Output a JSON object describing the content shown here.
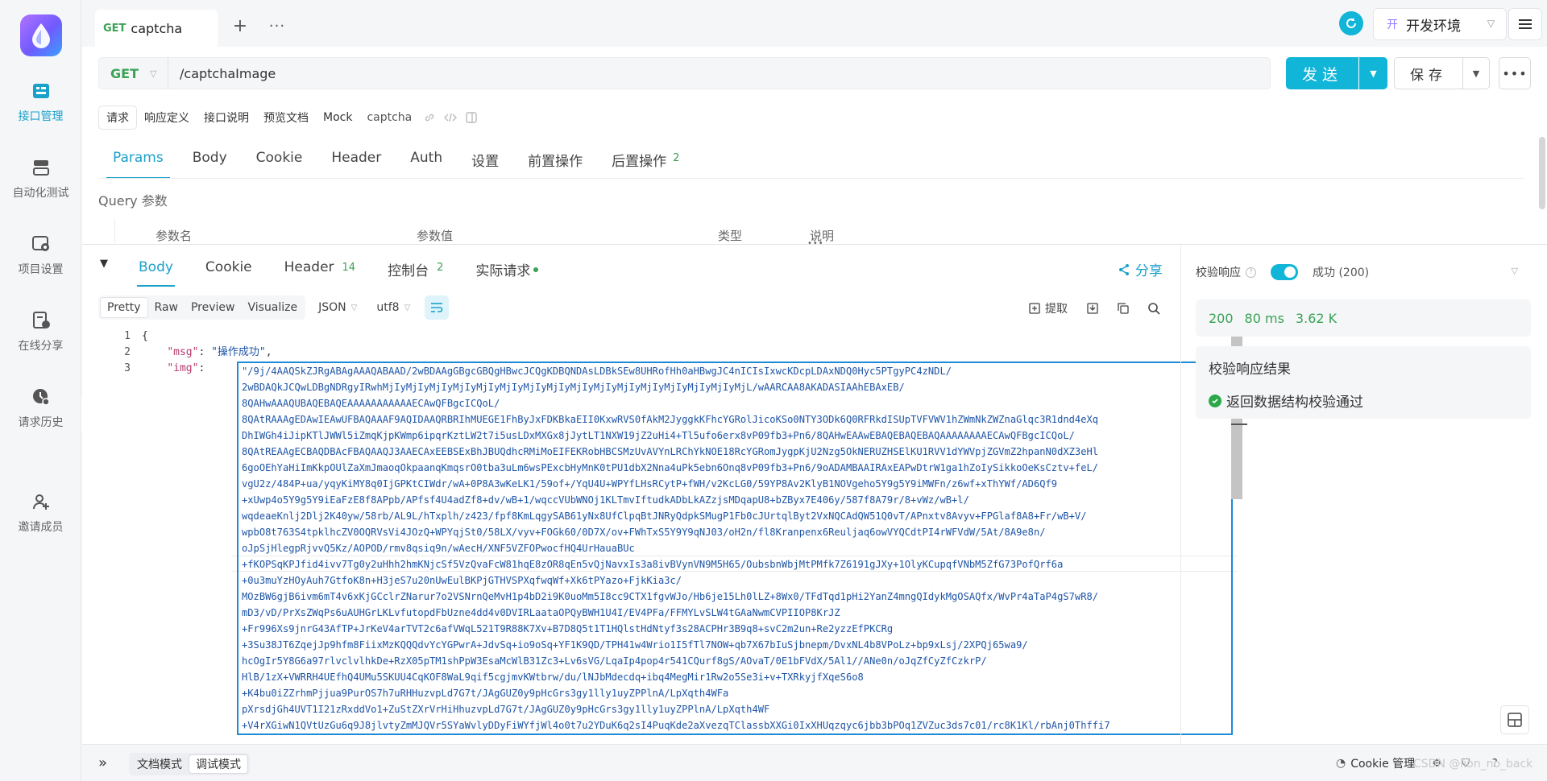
{
  "rail": {
    "items": [
      {
        "label": "接口管理",
        "icon": "api-icon",
        "active": true
      },
      {
        "label": "自动化测试",
        "icon": "automation-icon",
        "active": false
      },
      {
        "label": "项目设置",
        "icon": "project-settings-icon",
        "active": false
      },
      {
        "label": "在线分享",
        "icon": "share-doc-icon",
        "active": false
      },
      {
        "label": "请求历史",
        "icon": "history-icon",
        "active": false
      },
      {
        "label": "邀请成员",
        "icon": "invite-member-icon",
        "active": false
      }
    ],
    "toggle_glyph": "›"
  },
  "tabbar": {
    "tab_method": "GET",
    "tab_name": "captcha",
    "plus": "+",
    "more": "···",
    "env_badge": "开",
    "env_name": "开发环境"
  },
  "request": {
    "method": "GET",
    "url": "/captchaImage",
    "send_label": "发送",
    "save_label": "保存"
  },
  "mode_tabs": [
    "请求",
    "响应定义",
    "接口说明",
    "预览文档",
    "Mock"
  ],
  "api_name": "captcha",
  "req_tabs": [
    {
      "label": "Params",
      "count": ""
    },
    {
      "label": "Body",
      "count": ""
    },
    {
      "label": "Cookie",
      "count": ""
    },
    {
      "label": "Header",
      "count": ""
    },
    {
      "label": "Auth",
      "count": ""
    },
    {
      "label": "设置",
      "count": ""
    },
    {
      "label": "前置操作",
      "count": ""
    },
    {
      "label": "后置操作",
      "count": "2"
    }
  ],
  "query": {
    "title": "Query 参数",
    "columns": [
      "参数名",
      "参数值",
      "类型",
      "说明"
    ]
  },
  "response": {
    "tabs": [
      {
        "label": "Body",
        "count": ""
      },
      {
        "label": "Cookie",
        "count": ""
      },
      {
        "label": "Header",
        "count": "14"
      },
      {
        "label": "控制台",
        "count": "2"
      },
      {
        "label": "实际请求",
        "count": ""
      }
    ],
    "share_label": "分享",
    "formats": [
      "Pretty",
      "Raw",
      "Preview",
      "Visualize"
    ],
    "type_select": "JSON",
    "charset_select": "utf8",
    "extract_label": "提取",
    "line_numbers": [
      "1",
      "2",
      "3"
    ],
    "line1": "{",
    "msg_key": "\"msg\"",
    "msg_value": "\"操作成功\"",
    "img_key": "\"img\"",
    "img_lines": [
      "\"/9j/4AAQSkZJRgABAgAAAQABAAD/2wBDAAgGBgcGBQgHBwcJCQgKDBQNDAsLDBkSEw8UHRofHh0aHBwgJC4nICIsIxwcKDcpLDAxNDQ0Hyc5PTgyPC4zNDL/",
      "2wBDAQkJCQwLDBgNDRgyIRwhMjIyMjIyMjIyMjIyMjIyMjIyMjIyMjIyMjIyMjIyMjIyMjIyMjIyMjIyMjIyMjL/wAARCAA8AKADASIAAhEBAxEB/",
      "8QAHwAAAQUBAQEBAQEAAAAAAAAAAAECAwQFBgcICQoL/",
      "8QAtRAAAgEDAwIEAwUFBAQAAAF9AQIDAAQRBRIhMUEGE1FhByJxFDKBkaEII0KxwRVS0fAkM2JyggkKFhcYGRolJicoKSo0NTY3ODk6Q0RFRkdISUpTVFVWV1hZWmNkZWZnaGlqc3R1dnd4eXq",
      "DhIWGh4iJipKTlJWWl5iZmqKjpKWmp6ipqrKztLW2t7i5usLDxMXGx8jJytLT1NXW19jZ2uHi4+Tl5ufo6erx8vP09fb3+Pn6/8QAHwEAAwEBAQEBAQEBAQAAAAAAAAECAwQFBgcICQoL/",
      "8QAtREAAgECBAQDBAcFBAQAAQJ3AAECAxEEBSExBhJBUQdhcRMiMoEIFEKRobHBCSMzUvAVYnLRChYkNOE18RcYGRomJygpKjU2Nzg5OkNERUZHSElKU1RVV1dYWVpjZGVmZ2hpanN0dXZ3eHl",
      "6goOEhYaHiImKkpOUlZaXmJmaoqOkpaanqKmqsrO0tba3uLm6wsPExcbHyMnK0tPU1dbX2Nna4uPk5ebn6Onq8vP09fb3+Pn6/9oADAMBAAIRAxEAPwDtrW1ga1hZoIySikkoOeKsCztv+feL/",
      "vgU2z/484P+ua/yqyKiMY8q0IjGPKtCIWdr/wA+0P8A3wKeLK1/59of+/YqU4U+WPYfLHsRCytP+fWH/v2KcLG0/59YP8Av2KlyB1NOVgeho5Y9g5Y9iMWFn/z6wf+xThYWf/AD6Qf9",
      "+xUwp4o5Y9g5Y9iEaFzE8f8APpb/APfsf4U4adZf8+dv/wB+1/wqccVUbWNOj1KLTmvIftudkADbLkAZzjsMDqapU8+bZByx7E406y/587f8A79r/8+vWz/wB+l/",
      "wqdeaeKnlj2Dlj2K40yw/58rb/AL9L/hTxplh/z423/fpf8KmLqgySAB61yNx8UfClpqBtJNRyQdpkSMugP1Fb0cJUrtqlByt2VxNQCAdQW51Q0vT/APnxtv8Avyv+FPGlaf8A8+Fr/wB+V/",
      "wpbO8t763S4tpklhcZV0OQRVsVi4JOzQ+WPYqjSt0/58LX/vyv+FOGk60/0D7X/ov+FWhTxS5Y9Y9qNJ03/oH2n/fl8Kranpenx6Reuljaq6owVYQCdtPI4rWFVdW/5At/8A9e8n/",
      "oJpSjHlegpRjvvQ5Kz/AOPOD/rmv8qsiq9n/wAecH/XNF5VZFOPwocfHQ4UrHauaBUc",
      "+fKOPSqKPJfid4ivv7Tg0y2uHhh2hmKNjcSf5VzQvaFcW81hqE8zOR8qEn5vQjNavxIs3a8ivBVynVN9M5H65/OubsbnWbjMtPMfk7Z6191gJXy+1OlyKCupqfVNbM5ZfG73PofQrf6a",
      "+0u3muYzHOyAuh7GtfoK8n+H3jeS7u20nUwEulBKPjGTHVSPXqfwqWf+Xk6tPYazo+FjkKia3c/",
      "MOzBW6gjB6ivm6mT4v6xKjGCclrZNarur7o2VSNrnQeMvH1p4bD2i9K0uoMm5I8cc9CTX1fgvWJo/Hb6je15Lh0lLZ+8Wx0/TFdTqd1pHi2YanZ4mngQIdykMgOSAQfx/WvPr4aTaP4gS7wR8/",
      "mD3/vD/PrXsZWqPs6uAUHGrLKLvfutopdFbUzne4dd4v0DVIRLaataOPQyBWH1U4I/EV4PFa/FFMYLvSLW4tGAaNwmCVPIIOP8KrJZ",
      "+Fr996Xs9jnrG43AfTP+JrKeV4arTVT2c6afVWqL521T9R88K7Xv+B7D8Q5t1T1HQlstHdNtyf3s28ACPHr3B9q8+svC2m2un+Re2yzzEfPKCRg",
      "+3Su38JT6ZqejJp9hfm8FiixMzKQQQdvYcYGPwrA+JdvSq+io9oSq+YF1K9QD/TPH41w4Wrio1I5fTl7NOW+qb7X67bIuSjbnepm/DvxNL4b8VPoLz+bp9xLsj/2XPQj65wa9/",
      "hcOgIr5Y8G6a97rlvclvlhkDe+RzX05pTM1shPpW3EsaMcWlB31Zc3+Lv6sVG/LqaIp4pop4r541CQurf8gS/AOvaT/0E1bFVdX/5Al1//ANe0n/oJqZfCyZfCzkrP/",
      "HlB/1zX+VWRRH4UEfhQ4UMu5SKUU4CqKOF8WaL9qif5cgjmvKWtbrw/du/lNJbMdecdq+ibq4MegMir1Rw2o5Se3i+v+TXRkyjfXqeS6o8",
      "+K4bu0iZZrhmPjjua9PurOS7h7uRHHuzvpLd7G7t/JAgGUZ0y9pHcGrs3gy1lly1uyZPPlnA/LpXqth4WFa",
      "pXrsdjGh4UVT1I21zRxddVo1+ZuStZXrVrHiHhuzvpLd7G7t/JAgGUZ0y9pHcGrs3gy1lly1uyZPPlnA/LpXqth4WF",
      "+V4rXGiwN1QVtUzGu6q9J8jlvtyZmMJQVr5SYaWvlyDDyFiWYfjWl4o0t7u2YDuK6q2sI4PuqKde2aXvezqTClassbXXGi0IxXHUqzqyc6jbb3bPOq1ZVZuc3ds7c01/rc8K1Kl/rbAnj0Thffi7"
    ]
  },
  "verify": {
    "label": "校验响应",
    "status_text": "成功 (200)",
    "status_code": "200",
    "time": "80 ms",
    "size": "3.62 K",
    "result_title": "校验响应结果",
    "result_ok": "返回数据结构校验通过"
  },
  "statusbar": {
    "modes": [
      "文档模式",
      "调试模式"
    ],
    "cookie_label": "Cookie 管理",
    "watermark": "CSDN @lion_no_back"
  },
  "colors": {
    "accent": "#10b5d8",
    "method_get": "#3aa155",
    "highlight_border": "#1c8ad6"
  }
}
